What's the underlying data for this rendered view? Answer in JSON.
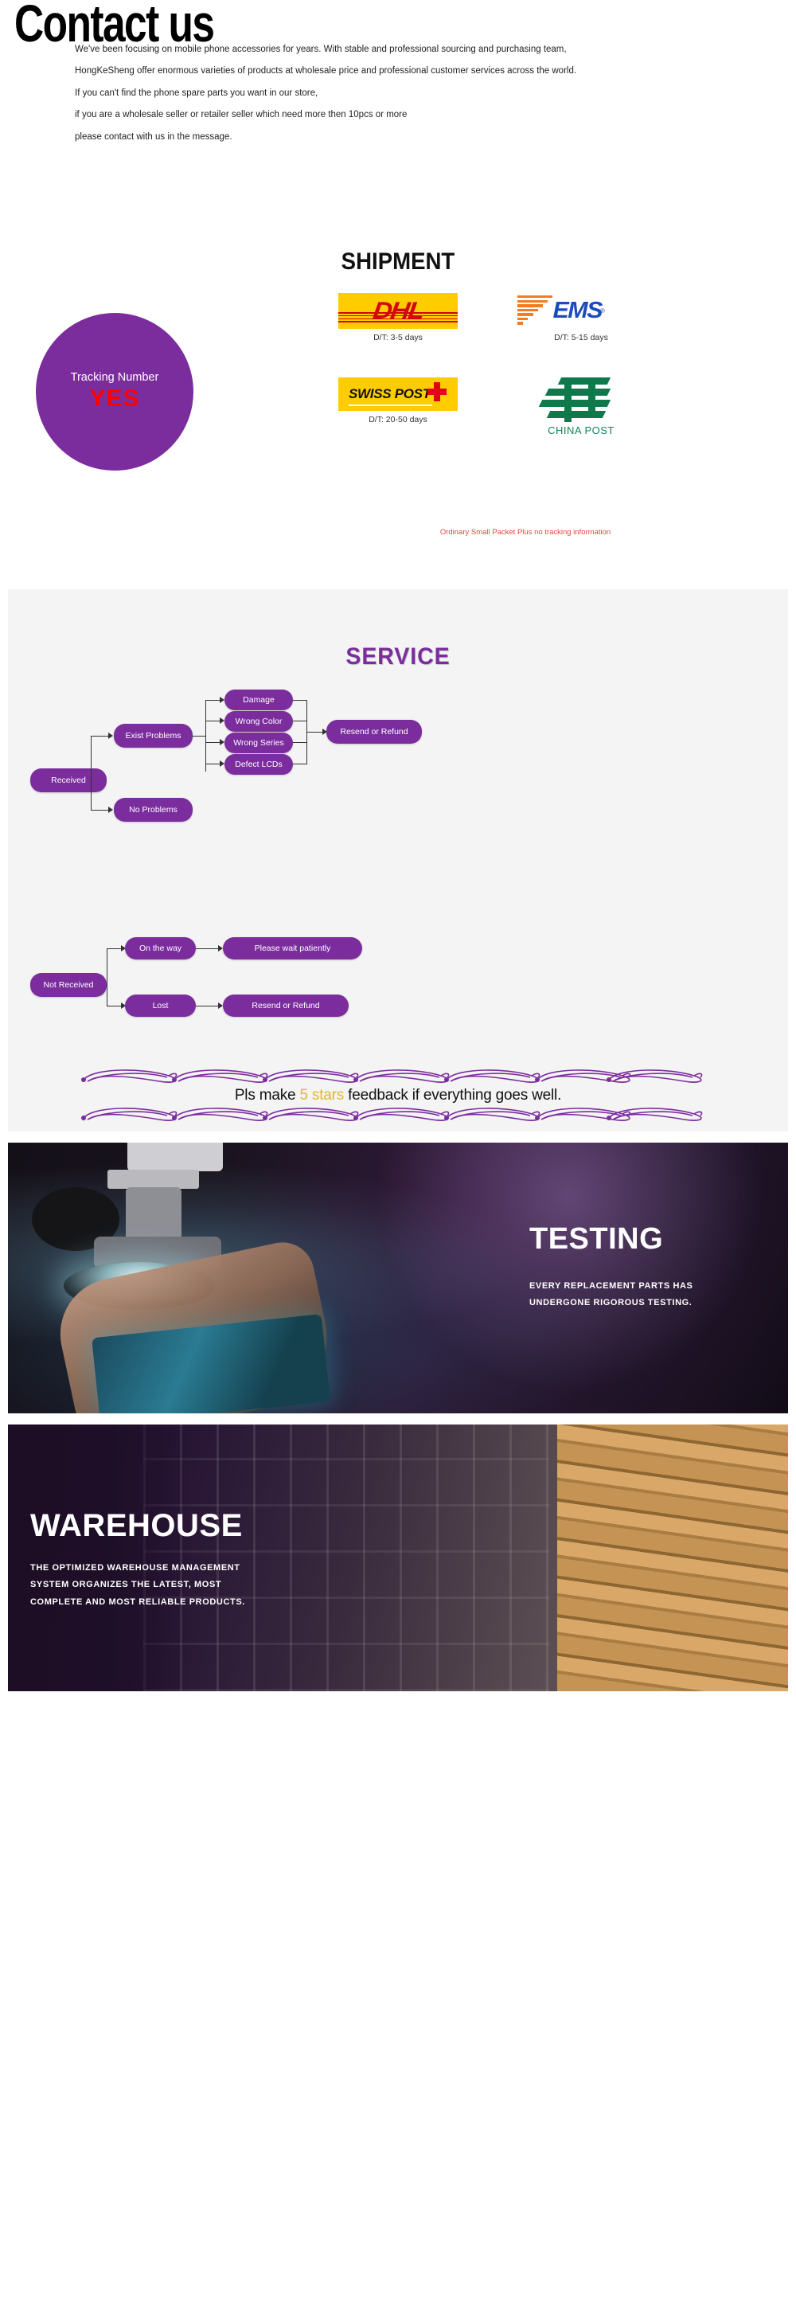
{
  "contact": {
    "title": "Contact us",
    "paragraphs": [
      "We've been focusing on mobile phone accessories for years. With stable and professional sourcing and purchasing team,",
      "HongKeSheng offer enormous varieties of products at wholesale price and professional customer services across the world."
    ],
    "red_line_1": "If you can't find the phone spare parts you want in our store,",
    "red_line_2": "if you are a wholesale seller or retailer seller which need more then 10pcs or more",
    "black_line": "please contact with us in the message."
  },
  "shipment": {
    "title": "SHIPMENT",
    "tracking_label": "Tracking Number",
    "tracking_value": "YES",
    "tracking_circle_color": "#7B2D9E",
    "tracking_value_color": "#FF0000",
    "carriers": [
      {
        "name": "DHL",
        "logo_text": "DHL",
        "delivery_time": "D/T: 3-5 days",
        "bg": "#FFCC00",
        "fg": "#D40511"
      },
      {
        "name": "EMS",
        "logo_text": "EMS",
        "delivery_time": "D/T: 5-15 days",
        "bg": "#FFFFFF",
        "fg": "#1A4BBF"
      },
      {
        "name": "SWISS POST",
        "logo_text": "SWISS POST",
        "delivery_time": "D/T: 20-50 days",
        "bg": "#FFCC00",
        "fg": "#111111"
      },
      {
        "name": "CHINA POST",
        "logo_text": "CHINA POST",
        "delivery_time": "",
        "bg": "#FFFFFF",
        "fg": "#12825A"
      }
    ],
    "note": "Ordinary Small Packet Plus no tracking information"
  },
  "service": {
    "title": "SERVICE",
    "accent_color": "#7B2D9E",
    "flow_received": {
      "start": "Received",
      "branch_problem": "Exist Problems",
      "branch_no_problem": "No Problems",
      "problems": [
        "Damage",
        "Wrong Color",
        "Wrong Series",
        "Defect LCDs"
      ],
      "outcome": "Resend or Refund"
    },
    "flow_not_received": {
      "start": "Not Received",
      "branches": [
        {
          "state": "On the way",
          "outcome": "Please wait patiently"
        },
        {
          "state": "Lost",
          "outcome": "Resend or Refund"
        }
      ]
    },
    "feedback_pre": "Pls make ",
    "feedback_stars": "5 stars",
    "feedback_post": " feedback if everything goes well.",
    "stars_color": "#E3B82A"
  },
  "testing": {
    "title": "TESTING",
    "line1": "EVERY REPLACEMENT PARTS HAS",
    "line2": "UNDERGONE RIGOROUS TESTING."
  },
  "warehouse": {
    "title": "WAREHOUSE",
    "line1": "THE OPTIMIZED WAREHOUSE MANAGEMENT",
    "line2": "SYSTEM ORGANIZES THE LATEST, MOST",
    "line3": "COMPLETE AND MOST RELIABLE PRODUCTS."
  }
}
